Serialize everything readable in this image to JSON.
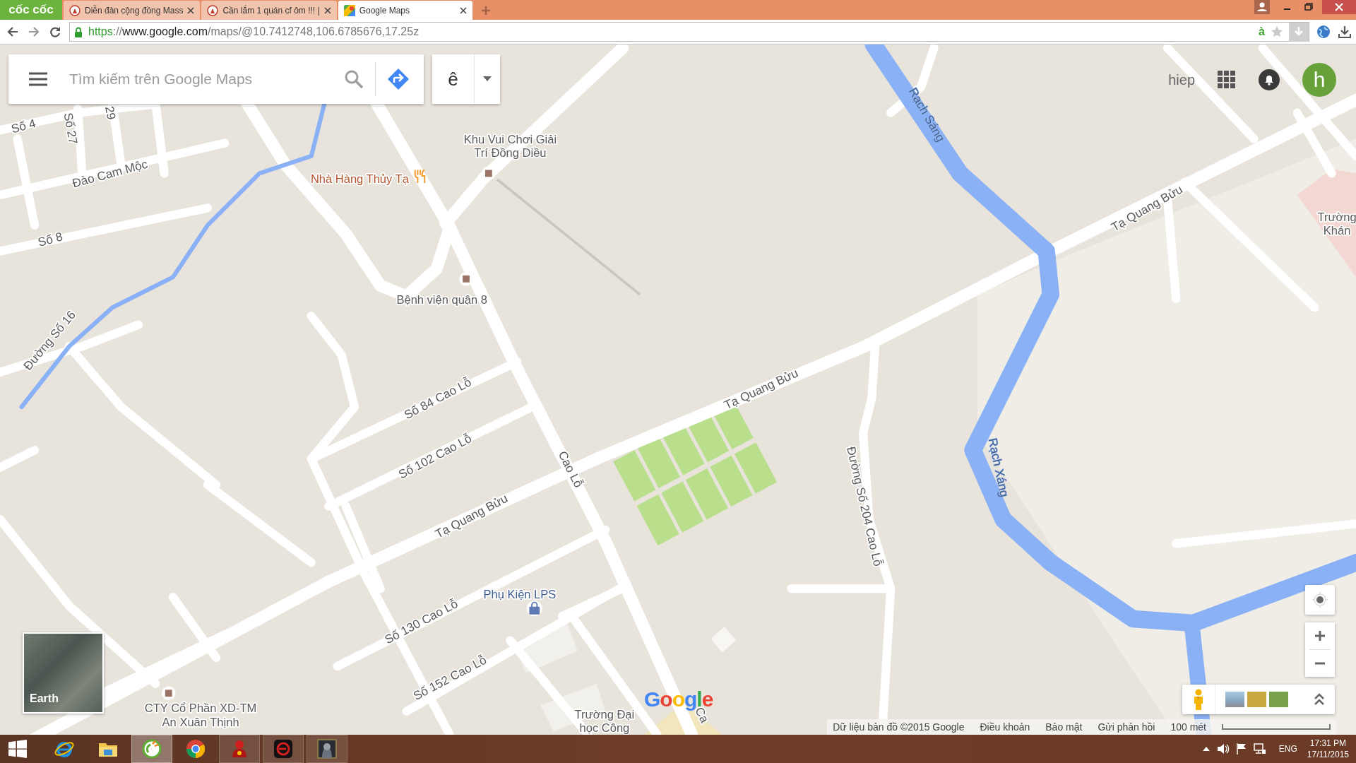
{
  "browser": {
    "logo": "cốc cốc",
    "tabs": [
      {
        "title": "Diễn đàn cộng đồng Mass",
        "kind": "forum",
        "selected": false
      },
      {
        "title": "Cần lắm 1 quán cf ôm !!! |",
        "kind": "forum",
        "selected": false
      },
      {
        "title": "Google Maps",
        "kind": "maps",
        "selected": true
      }
    ],
    "url_parts": [
      {
        "text": "https",
        "kind": "scheme"
      },
      {
        "text": "://",
        "kind": "rest"
      },
      {
        "text": "www.google.com",
        "kind": "host"
      },
      {
        "text": "/maps/@10.7412748,106.6785676,17.25z",
        "kind": "rest"
      }
    ],
    "extension_label": "à"
  },
  "search": {
    "placeholder": "Tìm kiếm trên Google Maps"
  },
  "input_tool": {
    "label": "ê"
  },
  "account": {
    "name": "hiep",
    "avatar_letter": "h"
  },
  "map_labels": [
    {
      "text": "Số 4",
      "kind": "street"
    },
    {
      "text": "Số 27",
      "kind": "street"
    },
    {
      "text": "29",
      "kind": "street"
    },
    {
      "text": "Đào Cam Mộc",
      "kind": "street"
    },
    {
      "text": "Số 8",
      "kind": "street"
    },
    {
      "text": "Đường Số 16",
      "kind": "street"
    },
    {
      "text": "Nhà Hàng Thủy Tạ",
      "kind": "food"
    },
    {
      "lines": [
        "Khu Vui Chơi Giải",
        "Trí Đồng Diều"
      ],
      "kind": "place"
    },
    {
      "text": "Bệnh viện quận 8",
      "kind": "place"
    },
    {
      "text": "Rạch Sáng",
      "kind": "water"
    },
    {
      "text": "Tạ Quang Bửu",
      "kind": "street"
    },
    {
      "lines": [
        "Trường",
        "Khán"
      ],
      "kind": "place"
    },
    {
      "text": "Số 84 Cao Lỗ",
      "kind": "street"
    },
    {
      "text": "Số 102 Cao Lỗ",
      "kind": "street"
    },
    {
      "text": "Tạ Quang Bửu",
      "kind": "street"
    },
    {
      "text": "Cao Lỗ",
      "kind": "street"
    },
    {
      "text": "Tạ Quang Bửu",
      "kind": "street"
    },
    {
      "text": "Đường Số 204 Cao Lỗ",
      "kind": "street"
    },
    {
      "text": "Rạch Xáng",
      "kind": "water"
    },
    {
      "text": "Phụ Kiện LPS",
      "kind": "shop"
    },
    {
      "text": "Số 130 Cao Lỗ",
      "kind": "street"
    },
    {
      "text": "Số 152 Cao Lỗ",
      "kind": "street"
    },
    {
      "lines": [
        "CTY Cổ Phần XD-TM",
        "An Xuân Thịnh"
      ],
      "kind": "place"
    },
    {
      "lines": [
        "Trường Đại",
        "học Công"
      ],
      "kind": "place"
    },
    {
      "text": "Ca",
      "kind": "street"
    }
  ],
  "earth": {
    "label": "Earth"
  },
  "logo": "Google",
  "footer": {
    "attribution": "Dữ liệu bản đồ ©2015 Google",
    "links": [
      "Điều khoản",
      "Bảo mật",
      "Gửi phản hồi"
    ],
    "scale": "100 mét"
  },
  "taskbar": {
    "items": [
      {
        "kind": "ie",
        "selected": false,
        "running": false
      },
      {
        "kind": "explorer",
        "selected": false,
        "running": false
      },
      {
        "kind": "coccoc",
        "selected": true,
        "running": true
      },
      {
        "kind": "chrome",
        "selected": false,
        "running": false
      },
      {
        "kind": "redapp",
        "selected": false,
        "running": true
      },
      {
        "kind": "game",
        "selected": false,
        "running": true
      },
      {
        "kind": "portrait",
        "selected": false,
        "running": true
      }
    ],
    "language": "ENG",
    "time": "17:31 PM",
    "date": "17/11/2015"
  }
}
